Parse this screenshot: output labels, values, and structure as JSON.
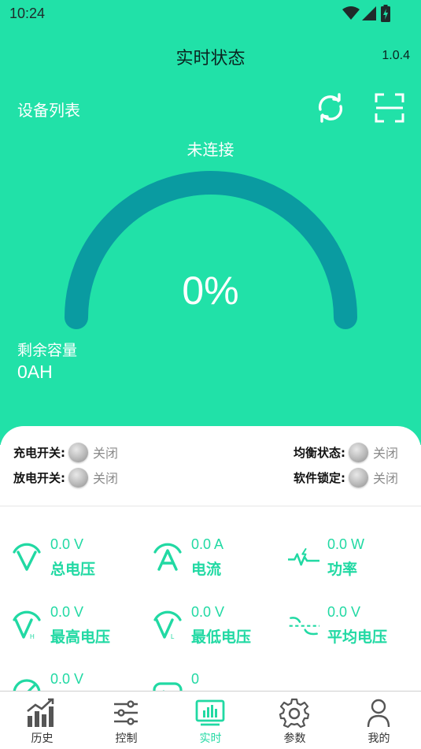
{
  "status_bar": {
    "time": "10:24"
  },
  "header": {
    "title": "实时状态",
    "version": "1.0.4",
    "device_list": "设备列表"
  },
  "connection": {
    "status": "未连接"
  },
  "gauge": {
    "percent_text": "0%",
    "level": 0,
    "color": "#0a9ba1"
  },
  "capacity": {
    "label": "剩余容量",
    "value": "0AH"
  },
  "switches": {
    "charge": {
      "label": "充电开关:",
      "state": "关闭"
    },
    "discharge": {
      "label": "放电开关:",
      "state": "关闭"
    },
    "balance": {
      "label": "均衡状态:",
      "state": "关闭"
    },
    "software_lock": {
      "label": "软件锁定:",
      "state": "关闭"
    }
  },
  "metrics": {
    "total_voltage": {
      "value": "0.0 V",
      "name": "总电压"
    },
    "current": {
      "value": "0.0 A",
      "name": "电流"
    },
    "power": {
      "value": "0.0 W",
      "name": "功率"
    },
    "max_voltage": {
      "value": "0.0 V",
      "name": "最高电压"
    },
    "min_voltage": {
      "value": "0.0 V",
      "name": "最低电压"
    },
    "avg_voltage": {
      "value": "0.0 V",
      "name": "平均电压"
    },
    "row3_left": {
      "value": "0.0 V"
    },
    "row3_mid": {
      "value": "0"
    }
  },
  "nav": {
    "history": "历史",
    "control": "控制",
    "realtime": "实时",
    "params": "参数",
    "mine": "我的"
  },
  "colors": {
    "primary": "#21e1a8",
    "accent": "#21d9a3",
    "gauge": "#0a9ba1"
  }
}
